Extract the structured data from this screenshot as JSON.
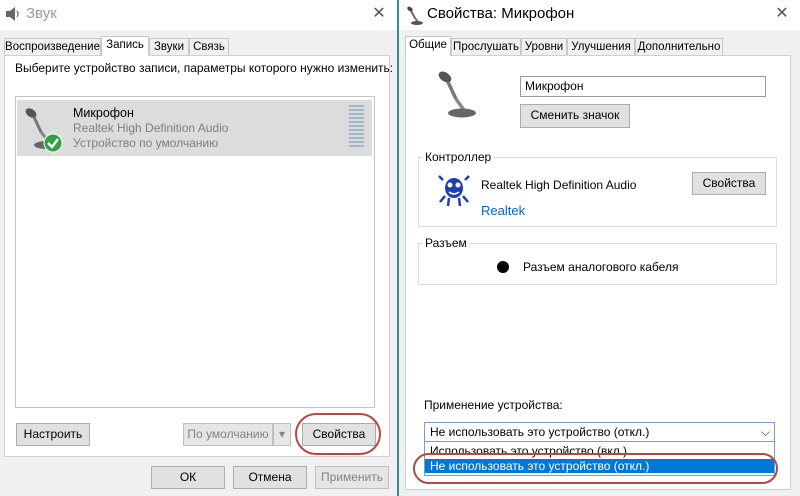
{
  "sound_window": {
    "title": "Звук",
    "tabs": [
      "Воспроизведение",
      "Запись",
      "Звуки",
      "Связь"
    ],
    "active_tab": "Запись",
    "instruction": "Выберите устройство записи, параметры которого нужно изменить:",
    "device": {
      "name": "Микрофон",
      "driver": "Realtek High Definition Audio",
      "status": "Устройство по умолчанию"
    },
    "buttons": {
      "configure": "Настроить",
      "set_default": "По умолчанию",
      "properties": "Свойства",
      "ok": "ОК",
      "cancel": "Отмена",
      "apply": "Применить"
    }
  },
  "properties_window": {
    "title": "Свойства: Микрофон",
    "tabs": [
      "Общие",
      "Прослушать",
      "Уровни",
      "Улучшения",
      "Дополнительно"
    ],
    "active_tab": "Общие",
    "device_name_value": "Микрофон",
    "change_icon_button": "Сменить значок",
    "controller": {
      "label": "Контроллер",
      "name": "Realtek High Definition Audio",
      "properties_button": "Свойства",
      "vendor_link": "Realtek"
    },
    "jack": {
      "label": "Разъем",
      "value": "Разъем аналогового кабеля"
    },
    "usage": {
      "label": "Применение устройства:",
      "selected": "Не использовать это устройство (откл.)",
      "options": [
        "Использовать это устройство (вкл.)",
        "Не использовать это устройство (откл.)"
      ]
    }
  },
  "colors": {
    "highlight": "#0078d7",
    "annotation": "#b04a42",
    "link": "#0066cc"
  }
}
